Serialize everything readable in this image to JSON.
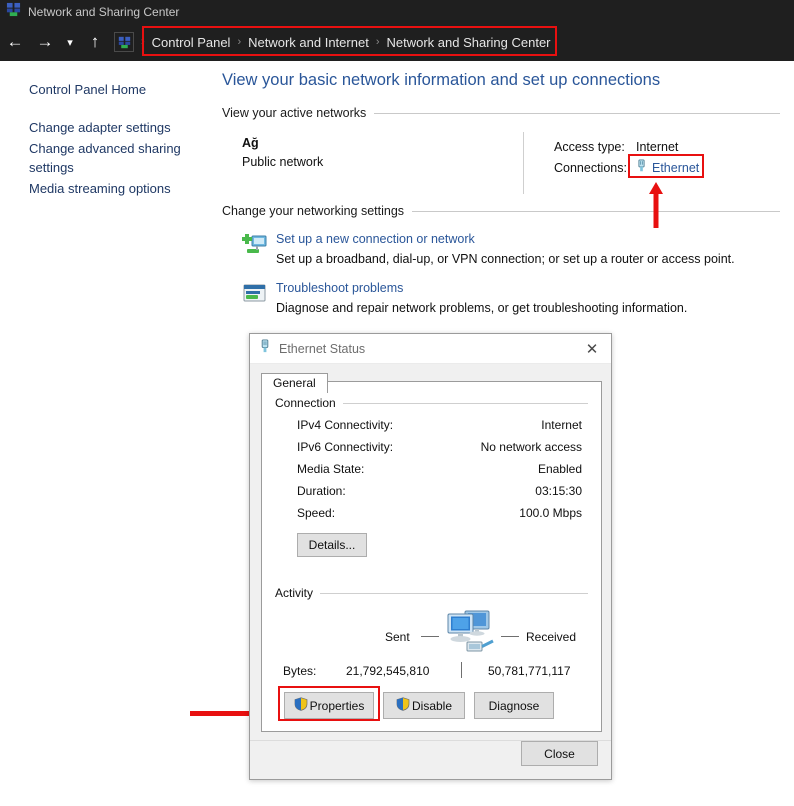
{
  "window": {
    "title": "Network and Sharing Center",
    "icon": "network-sharing-icon"
  },
  "nav": {
    "back_icon": "back-arrow-icon",
    "forward_icon": "forward-arrow-icon",
    "history_icon": "chevron-down-icon",
    "up_icon": "up-arrow-icon",
    "address_icon": "network-sharing-icon",
    "breadcrumbs": [
      {
        "label": "Control Panel"
      },
      {
        "label": "Network and Internet"
      },
      {
        "label": "Network and Sharing Center"
      }
    ],
    "separator": "›"
  },
  "sidebar": {
    "items": [
      {
        "label": "Control Panel Home"
      },
      {
        "label": "Change adapter settings"
      },
      {
        "label": "Change advanced sharing settings"
      },
      {
        "label": "Media streaming options"
      }
    ]
  },
  "main": {
    "heading": "View your basic network information and set up connections",
    "active_networks_header": "View your active networks",
    "active_network": {
      "name": "Ağ",
      "type": "Public network",
      "access_type_label": "Access type:",
      "access_type_value": "Internet",
      "connections_label": "Connections:",
      "connections_value": "Ethernet",
      "connections_icon": "ethernet-plug-icon"
    },
    "settings_header": "Change your networking settings",
    "tasks": [
      {
        "icon": "new-connection-icon",
        "link": "Set up a new connection or network",
        "description": "Set up a broadband, dial-up, or VPN connection; or set up a router or access point."
      },
      {
        "icon": "troubleshoot-icon",
        "link": "Troubleshoot problems",
        "description": "Diagnose and repair network problems, or get troubleshooting information."
      }
    ]
  },
  "dialog": {
    "title": "Ethernet Status",
    "title_icon": "ethernet-plug-icon",
    "close_icon": "close-icon",
    "tabs": [
      {
        "label": "General"
      }
    ],
    "connection": {
      "group_label": "Connection",
      "rows": [
        {
          "key": "IPv4 Connectivity:",
          "value": "Internet"
        },
        {
          "key": "IPv6 Connectivity:",
          "value": "No network access"
        },
        {
          "key": "Media State:",
          "value": "Enabled"
        },
        {
          "key": "Duration:",
          "value": "03:15:30"
        },
        {
          "key": "Speed:",
          "value": "100.0 Mbps"
        }
      ],
      "details_button": "Details..."
    },
    "activity": {
      "group_label": "Activity",
      "sent_label": "Sent",
      "received_label": "Received",
      "art_icon": "two-monitors-network-icon",
      "bytes_label": "Bytes:",
      "bytes_sent": "21,792,545,810",
      "bytes_received": "50,781,771,117"
    },
    "buttons": {
      "properties": "Properties",
      "disable": "Disable",
      "diagnose": "Diagnose",
      "close": "Close",
      "shield_icon": "uac-shield-icon"
    }
  },
  "annotations": {
    "accent_color": "#e81010",
    "arrow_to_ethernet": "arrow-up-annotation",
    "arrow_to_properties": "arrow-right-annotation"
  }
}
